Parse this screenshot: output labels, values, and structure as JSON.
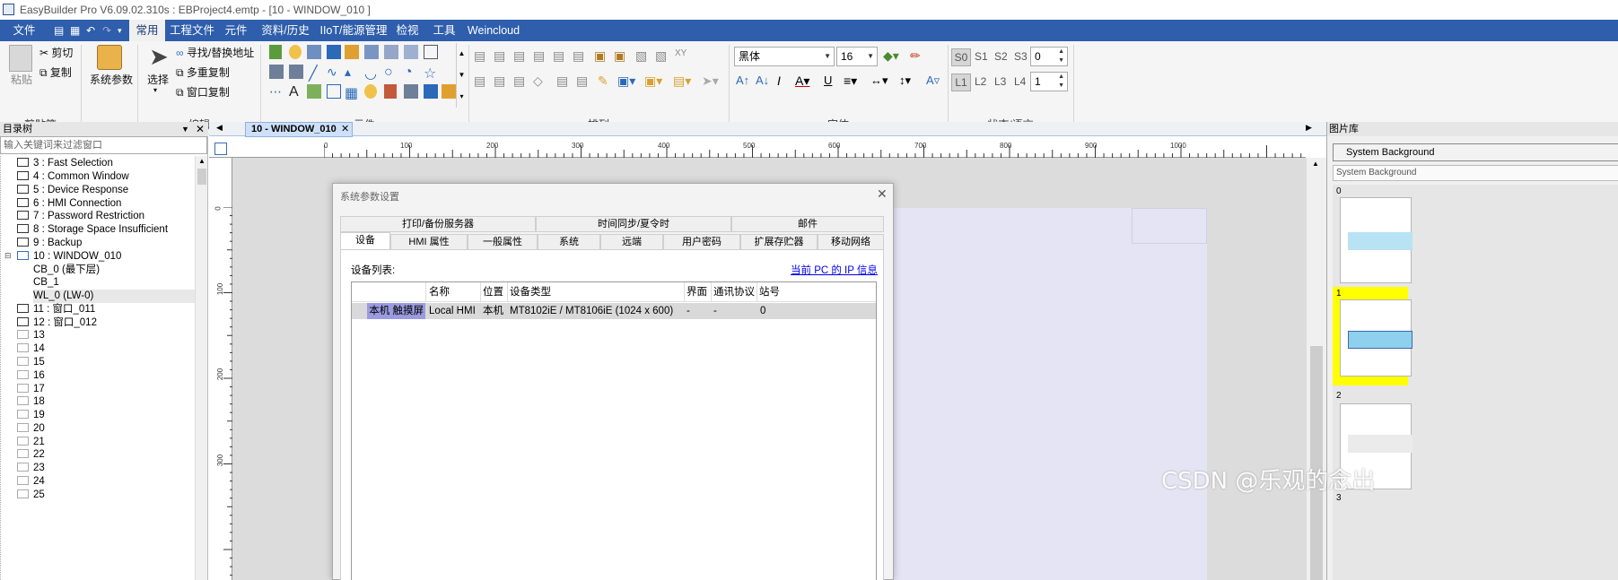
{
  "titlebar": {
    "title": "EasyBuilder Pro V6.09.02.310s : EBProject4.emtp - [10 - WINDOW_010 ]"
  },
  "menubar": {
    "items": [
      "文件",
      "常用",
      "工程文件",
      "元件",
      "资料/历史",
      "IIoT/能源管理",
      "检视",
      "工具",
      "Weincloud"
    ]
  },
  "ribbon": {
    "clipboard": {
      "paste": "粘贴",
      "cut": "剪切",
      "copy": "复制",
      "group": "剪贴簿"
    },
    "sysparam": {
      "label": "系统参数"
    },
    "edit": {
      "select": "选择",
      "find": "寻找/替换地址",
      "multi": "多重复制",
      "windowcopy": "窗口复制",
      "group": "编辑"
    },
    "element": {
      "group": "元件"
    },
    "arrange": {
      "group": "排列"
    },
    "font": {
      "name": "黑体",
      "size": "16",
      "group": "字体"
    },
    "state": {
      "s": [
        "S0",
        "S1",
        "S2",
        "S3"
      ],
      "sval": "0",
      "l": [
        "L1",
        "L2",
        "L3",
        "L4"
      ],
      "lval": "1",
      "group": "状态/语言"
    }
  },
  "left": {
    "header": "目录树",
    "filter_placeholder": "输入关键词来过滤窗口",
    "items": [
      "3 : Fast Selection",
      "4 : Common Window",
      "5 : Device Response",
      "6 : HMI Connection",
      "7 : Password Restriction",
      "8 : Storage Space Insufficient",
      "9 : Backup",
      "10 : WINDOW_010",
      "CB_0 (最下层)",
      "CB_1",
      "WL_0 (LW-0)",
      "11 : 窗口_011",
      "12 : 窗口_012",
      "13",
      "14",
      "15",
      "16",
      "17",
      "18",
      "19",
      "20",
      "21",
      "22",
      "23",
      "24",
      "25"
    ]
  },
  "doc": {
    "tab": "10 - WINDOW_010",
    "ruler_h": [
      "0",
      "100",
      "200",
      "300",
      "400",
      "500",
      "600",
      "700",
      "800",
      "900",
      "1000"
    ],
    "ruler_v": [
      "0",
      "100",
      "200",
      "300"
    ]
  },
  "dialog": {
    "title": "系统参数设置",
    "tabs_top": [
      "打印/备份服务器",
      "时间同步/夏令时",
      "邮件"
    ],
    "tabs_bottom": [
      "设备",
      "HMI 属性",
      "一般属性",
      "系统",
      "远端",
      "用户密码",
      "扩展存贮器",
      "移动网络"
    ],
    "list_label": "设备列表:",
    "ip_link": "当前 PC 的 IP 信息",
    "columns": [
      "名称",
      "位置",
      "设备类型",
      "界面",
      "通讯协议",
      "站号"
    ],
    "row": {
      "kind": "本机 触摸屏",
      "name": "Local HMI",
      "loc": "本机",
      "type": "MT8102iE / MT8106iE (1024 x 600)",
      "iface": "-",
      "proto": "-",
      "station": "0"
    }
  },
  "right": {
    "header": "图片库",
    "btn": "System Background",
    "sub": "System Background",
    "thumbs": [
      "0",
      "1",
      "2",
      "3"
    ]
  },
  "watermark": "CSDN @乐观的念出"
}
